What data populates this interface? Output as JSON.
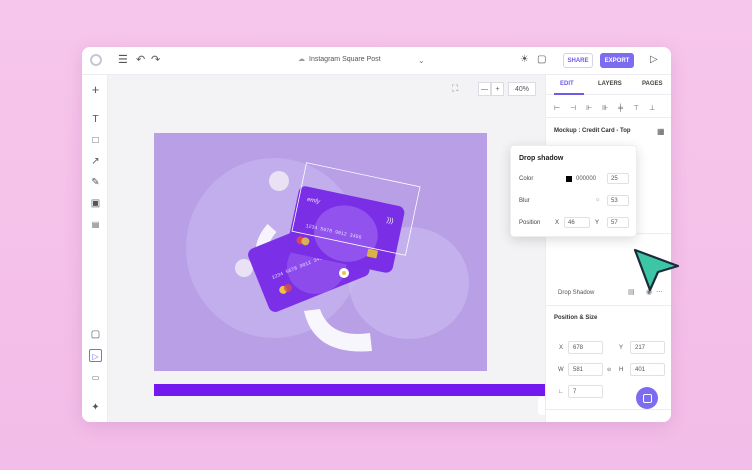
{
  "topbar": {
    "doc_title": "Instagram Square Post",
    "share_label": "SHARE",
    "export_label": "EXPORT"
  },
  "canvas": {
    "zoom_minus": "—",
    "zoom_plus": "+",
    "zoom_value": "40%",
    "card_brand": "emfy",
    "card_number": "1234 5678 9012 3456",
    "artboard_color": "#b89fe6",
    "card_color": "#7a2ee6"
  },
  "panel": {
    "tabs": [
      "EDIT",
      "LAYERS",
      "PAGES"
    ],
    "active_tab": "EDIT",
    "mockup_title": "Mockup : Credit Card - Top",
    "effect_name": "Drop Shadow",
    "position_size_label": "Position & Size",
    "x_label": "X",
    "x_value": "678",
    "y_label": "Y",
    "y_value": "217",
    "w_label": "W",
    "w_value": "581",
    "h_label": "H",
    "h_value": "401",
    "rotation_label": "∟",
    "rotation_value": "7",
    "accent": "#7b6cf0"
  },
  "popover": {
    "title": "Drop shadow",
    "color_label": "Color",
    "color_hex": "000000",
    "color_opacity": "25",
    "blur_label": "Blur",
    "blur_value": "53",
    "position_label": "Position",
    "pos_x_label": "X",
    "pos_x_value": "46",
    "pos_y_label": "Y",
    "pos_y_value": "57"
  }
}
